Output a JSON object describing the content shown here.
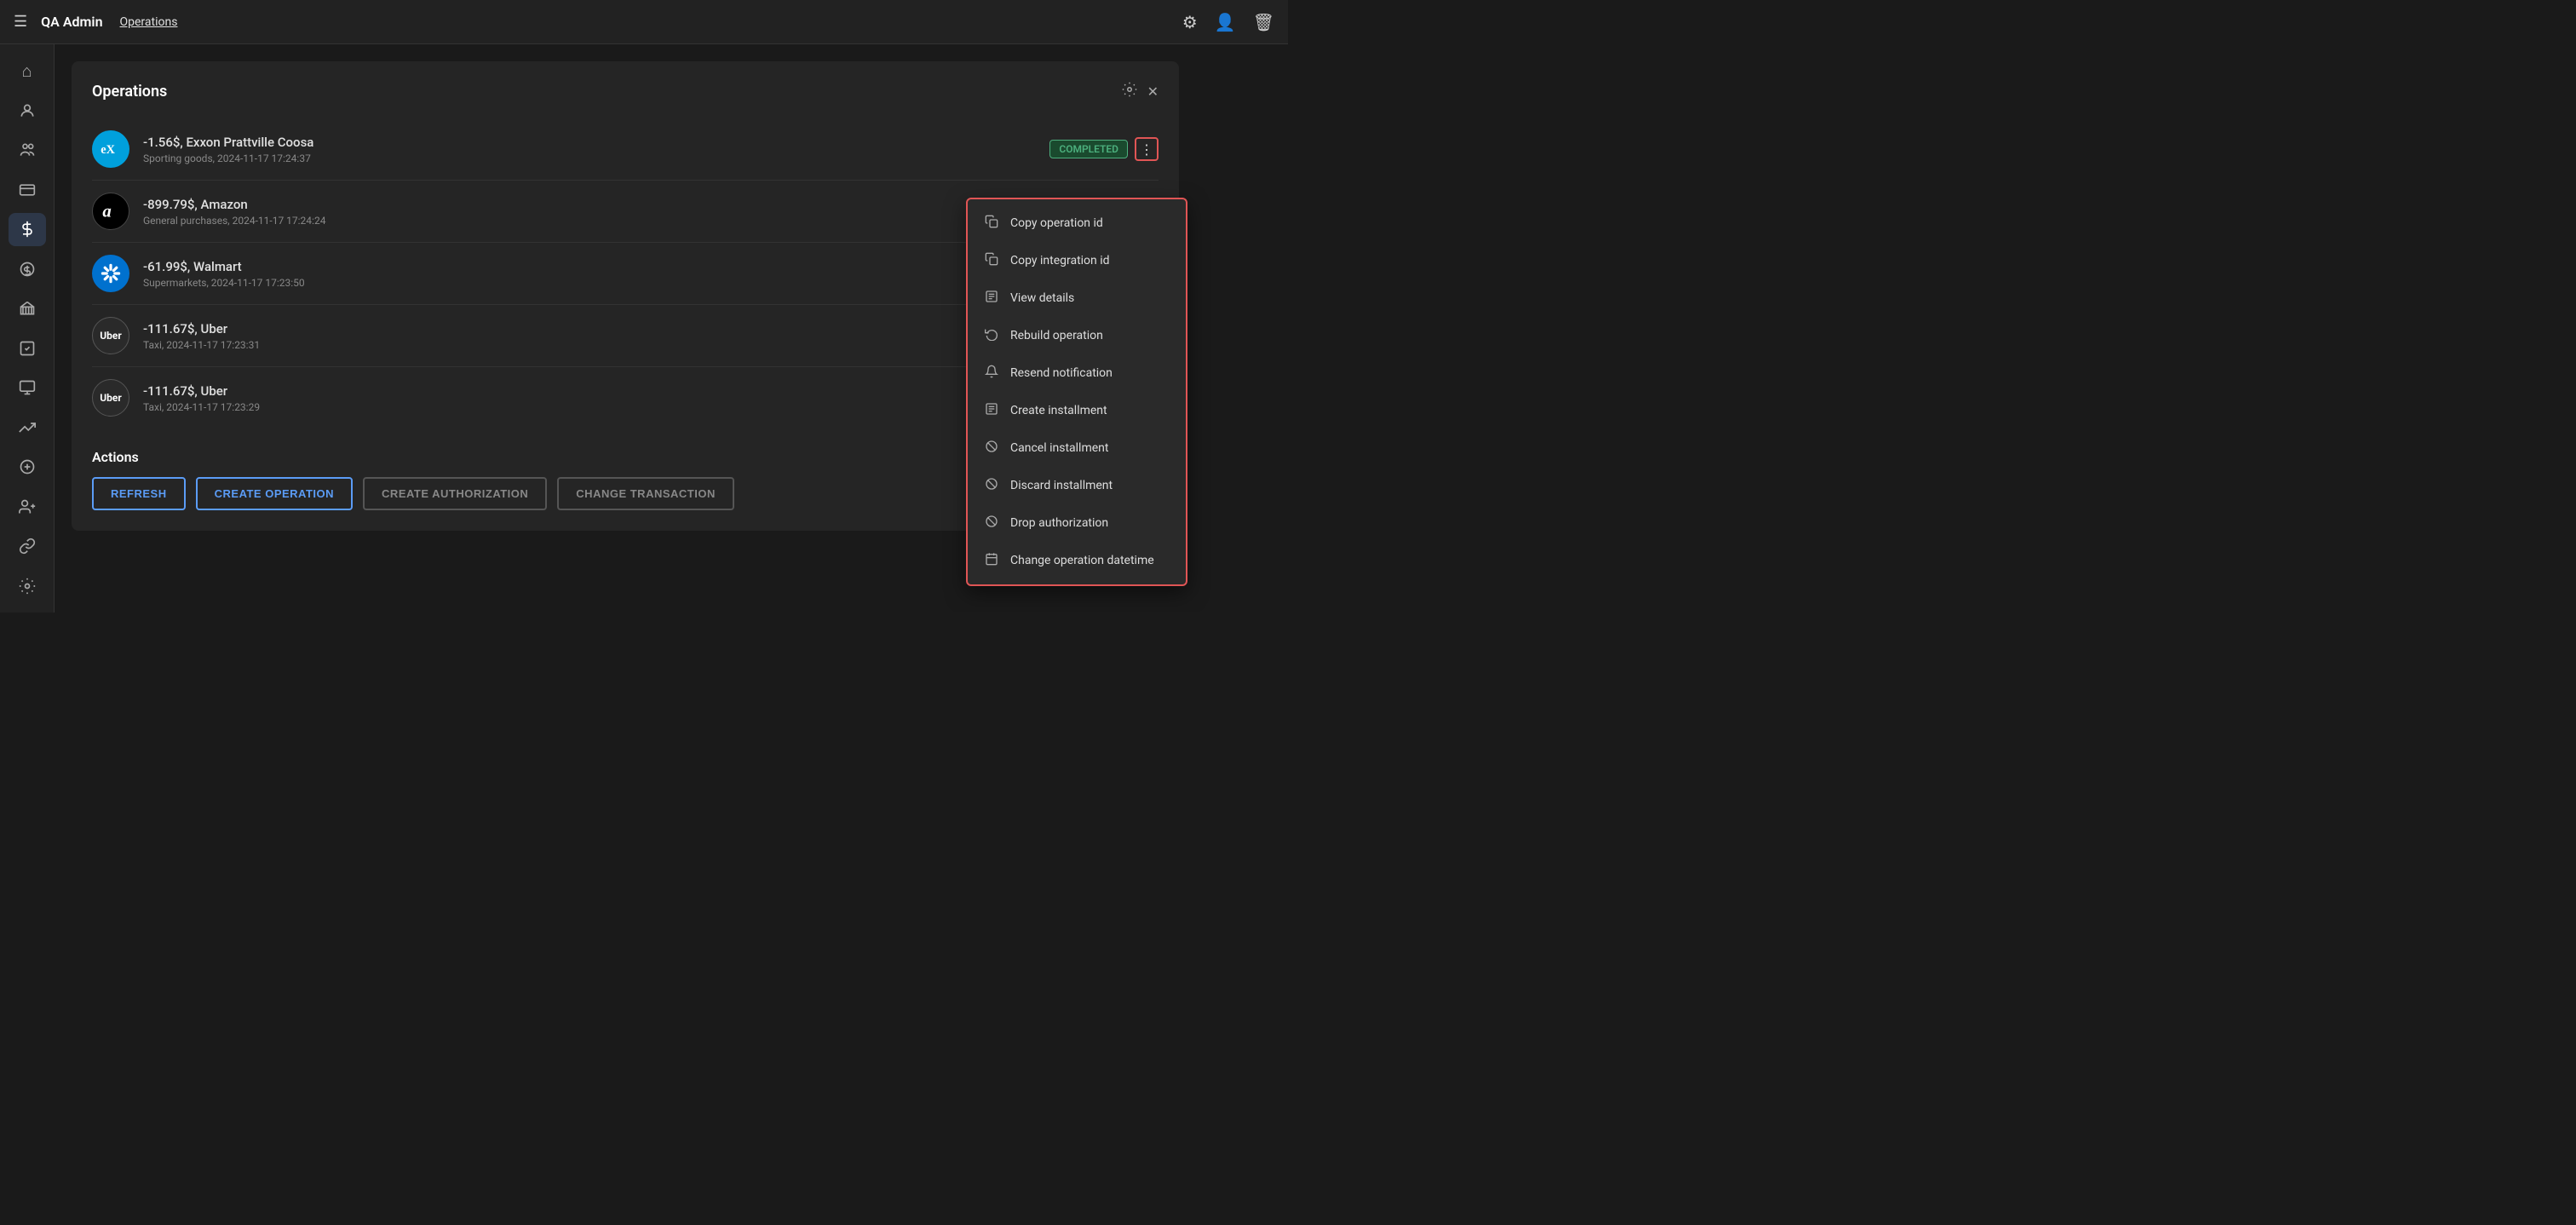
{
  "header": {
    "menu_label": "☰",
    "app_title": "QA Admin",
    "nav_link": "Operations",
    "icons": {
      "settings": "⚙",
      "users": "👤",
      "trash": "🗑"
    }
  },
  "sidebar": {
    "items": [
      {
        "id": "home",
        "icon": "⌂",
        "active": false
      },
      {
        "id": "user",
        "icon": "👤",
        "active": false
      },
      {
        "id": "users",
        "icon": "👥",
        "active": false
      },
      {
        "id": "card",
        "icon": "💳",
        "active": false
      },
      {
        "id": "dollar",
        "icon": "$",
        "active": true
      },
      {
        "id": "dollar-s",
        "icon": "⊕",
        "active": false
      },
      {
        "id": "bank",
        "icon": "🏛",
        "active": false
      },
      {
        "id": "task",
        "icon": "☑",
        "active": false
      },
      {
        "id": "screen",
        "icon": "⊞",
        "active": false
      },
      {
        "id": "chart",
        "icon": "↗",
        "active": false
      },
      {
        "id": "add-circle",
        "icon": "⊕",
        "active": false
      },
      {
        "id": "person-add",
        "icon": "👤+",
        "active": false
      },
      {
        "id": "link",
        "icon": "🔗",
        "active": false
      },
      {
        "id": "settings2",
        "icon": "⚙",
        "active": false
      }
    ]
  },
  "panel": {
    "title": "Operations",
    "settings_icon": "⚙",
    "close_icon": "✕"
  },
  "operations": [
    {
      "id": "op1",
      "logo_type": "exxon",
      "logo_text": "E",
      "title": "-1.56$, Exxon Prattville Coosa",
      "subtitle": "Sporting goods, 2024-11-17 17:24:37",
      "status": "COMPLETED",
      "show_more": true
    },
    {
      "id": "op2",
      "logo_type": "amazon",
      "logo_text": "a",
      "title": "-899.79$, Amazon",
      "subtitle": "General purchases, 2024-11-17 17:24:24",
      "status": "",
      "show_more": false
    },
    {
      "id": "op3",
      "logo_type": "walmart",
      "logo_text": "★",
      "title": "-61.99$, Walmart",
      "subtitle": "Supermarkets, 2024-11-17 17:23:50",
      "status": "",
      "show_more": false
    },
    {
      "id": "op4",
      "logo_type": "uber",
      "logo_text": "Uber",
      "title": "-111.67$, Uber",
      "subtitle": "Taxi, 2024-11-17 17:23:31",
      "status": "",
      "show_more": false
    },
    {
      "id": "op5",
      "logo_type": "uber",
      "logo_text": "Uber",
      "title": "-111.67$, Uber",
      "subtitle": "Taxi, 2024-11-17 17:23:29",
      "status": "",
      "show_more": false
    }
  ],
  "context_menu": {
    "items": [
      {
        "id": "copy-op-id",
        "icon": "⧉",
        "label": "Copy operation id"
      },
      {
        "id": "copy-int-id",
        "icon": "⧉",
        "label": "Copy integration id"
      },
      {
        "id": "view-details",
        "icon": "≡",
        "label": "View details"
      },
      {
        "id": "rebuild-op",
        "icon": "↻",
        "label": "Rebuild operation"
      },
      {
        "id": "resend-notif",
        "icon": "🔔",
        "label": "Resend notification"
      },
      {
        "id": "create-install",
        "icon": "≡",
        "label": "Create installment"
      },
      {
        "id": "cancel-install",
        "icon": "⊘",
        "label": "Cancel installment"
      },
      {
        "id": "discard-install",
        "icon": "⊘",
        "label": "Discard installment"
      },
      {
        "id": "drop-auth",
        "icon": "⊘",
        "label": "Drop authorization"
      },
      {
        "id": "change-datetime",
        "icon": "📅",
        "label": "Change operation datetime"
      }
    ]
  },
  "actions": {
    "title": "Actions",
    "buttons": [
      {
        "id": "refresh",
        "label": "REFRESH",
        "type": "primary"
      },
      {
        "id": "create-operation",
        "label": "CREATE OPERATION",
        "type": "primary"
      },
      {
        "id": "create-authorization",
        "label": "CREATE AUTHORIZATION",
        "type": "secondary"
      },
      {
        "id": "change-transaction",
        "label": "CHANGE TRANSACTION",
        "type": "secondary"
      }
    ]
  }
}
